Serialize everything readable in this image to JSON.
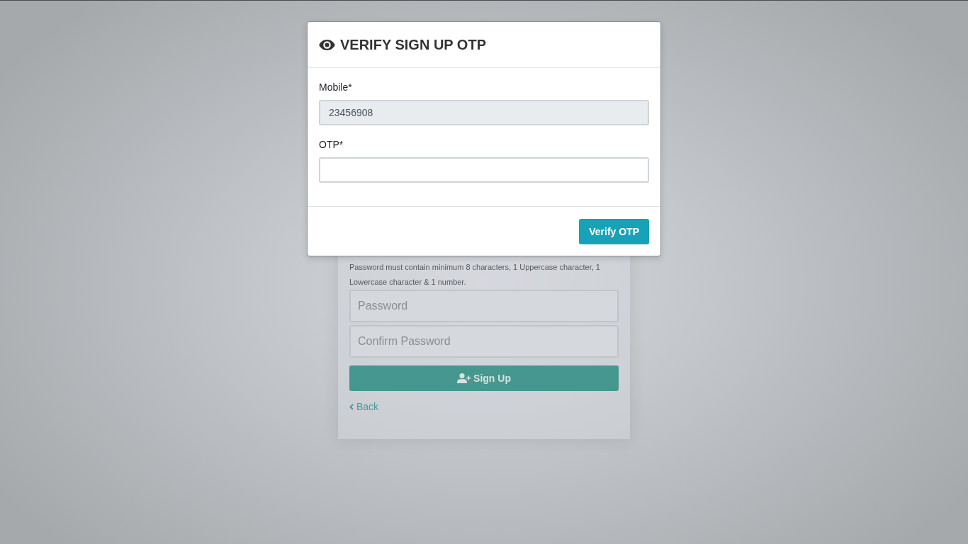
{
  "signup_form": {
    "password_hint": "Password must contain minimum 8 characters, 1 Uppercase character, 1 Lowercase character & 1 number.",
    "password_field": {
      "placeholder": "Password"
    },
    "confirm_password_field": {
      "placeholder": "Confirm Password"
    },
    "signup_button": {
      "label": "Sign Up"
    },
    "back_link": {
      "label": "Back"
    }
  },
  "modal": {
    "title": "VERIFY SIGN UP OTP",
    "fields": [
      {
        "label": "Mobile*",
        "value": "23456908",
        "disabled": true
      },
      {
        "label": "OTP*",
        "disabled": false
      }
    ],
    "buttons": [
      {
        "label": "Verify OTP"
      }
    ]
  }
}
